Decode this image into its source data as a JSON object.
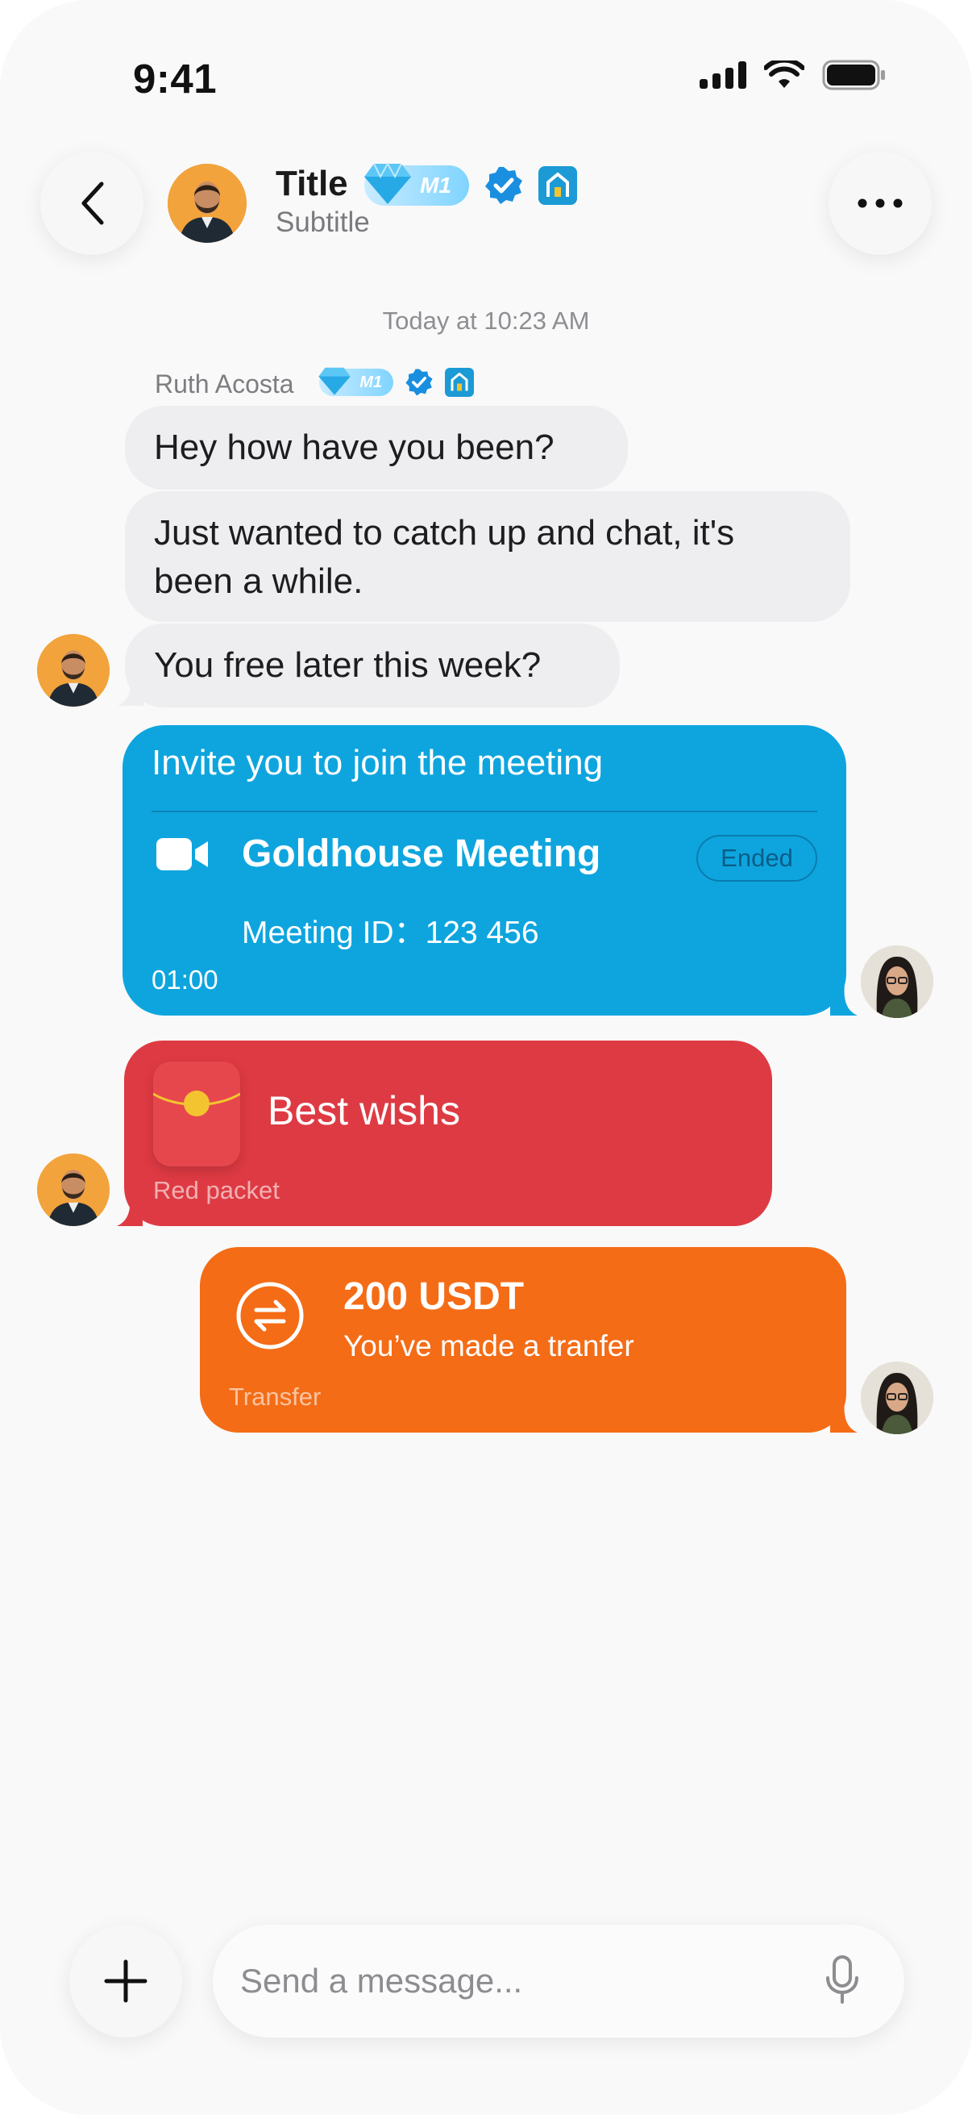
{
  "status_bar": {
    "time": "9:41"
  },
  "header": {
    "title": "Title",
    "subtitle": "Subtitle",
    "level_badge": "M1"
  },
  "conversation": {
    "timestamp": "Today at 10:23 AM",
    "sender_name": "Ruth Acosta",
    "sender_level_badge": "M1",
    "messages": [
      {
        "text": "Hey how have you been?"
      },
      {
        "text": "Just wanted to catch up and chat, it's been a while."
      },
      {
        "text": "You free later this week?"
      }
    ]
  },
  "meeting_card": {
    "invite_text": "Invite you to join the meeting",
    "name": "Goldhouse Meeting",
    "status": "Ended",
    "meeting_id": "Meeting ID：123 456",
    "duration": "01:00"
  },
  "red_packet": {
    "title": "Best wishs",
    "label": "Red packet"
  },
  "transfer": {
    "amount": "200 USDT",
    "description": "You’ve made a tranfer",
    "label": "Transfer"
  },
  "composer": {
    "placeholder": "Send a message..."
  },
  "colors": {
    "accent_blue": "#0ea5de",
    "red_packet": "#de3a43",
    "transfer_orange": "#f46c16",
    "incoming_bubble": "#eeeef1"
  },
  "icons": [
    "back-chevron-icon",
    "more-dots-icon",
    "verified-icon",
    "home-badge-icon",
    "gem-icon",
    "video-camera-icon",
    "transfer-arrows-icon",
    "plus-icon",
    "microphone-icon"
  ]
}
